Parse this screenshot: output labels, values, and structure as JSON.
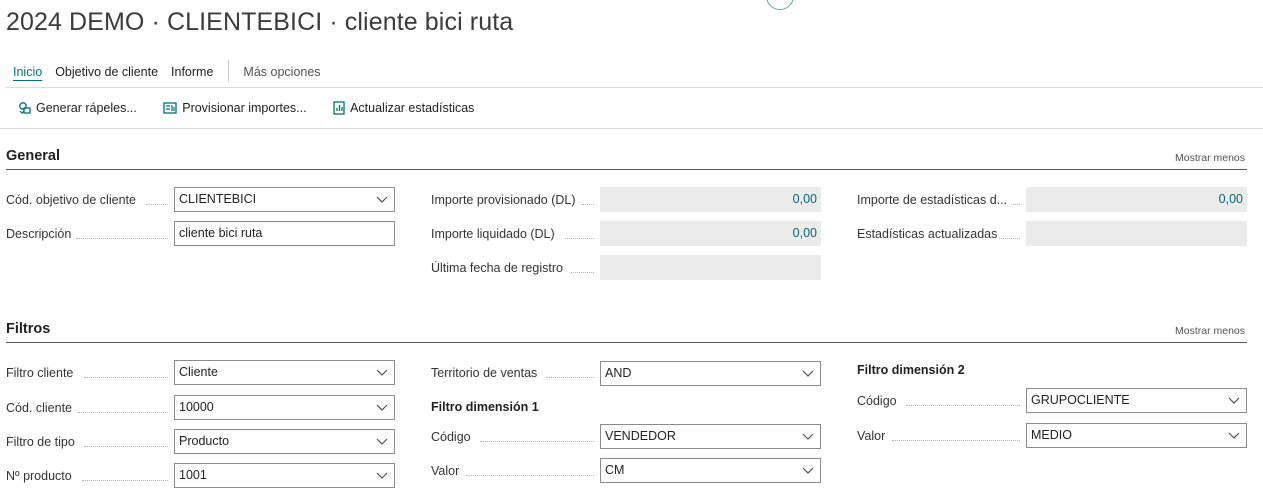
{
  "page_title": "2024 DEMO · CLIENTEBICI · cliente bici ruta",
  "nav": {
    "tabs": [
      "Inicio",
      "Objetivo de cliente",
      "Informe"
    ],
    "more": "Más opciones"
  },
  "actions": [
    {
      "label": "Generar rápeles...",
      "icon": "generate-icon"
    },
    {
      "label": "Provisionar importes...",
      "icon": "provision-icon"
    },
    {
      "label": "Actualizar estadísticas",
      "icon": "statistics-icon"
    }
  ],
  "general": {
    "title": "General",
    "more": "Mostrar menos",
    "cod_objetivo": {
      "label": "Cód. objetivo de cliente",
      "value": "CLIENTEBICI"
    },
    "descripcion": {
      "label": "Descripción",
      "value": "cliente bici ruta"
    },
    "importe_provisionado": {
      "label": "Importe provisionado (DL)",
      "value": "0,00"
    },
    "importe_liquidado": {
      "label": "Importe liquidado (DL)",
      "value": "0,00"
    },
    "ultima_fecha": {
      "label": "Última fecha de registro",
      "value": ""
    },
    "importe_estadisticas": {
      "label": "Importe de estadísticas d...",
      "value": "0,00"
    },
    "estadisticas_actualizadas": {
      "label": "Estadísticas actualizadas",
      "value": ""
    }
  },
  "filtros": {
    "title": "Filtros",
    "more": "Mostrar menos",
    "filtro_cliente": {
      "label": "Filtro cliente",
      "value": "Cliente"
    },
    "cod_cliente": {
      "label": "Cód. cliente",
      "value": "10000"
    },
    "filtro_tipo": {
      "label": "Filtro de tipo",
      "value": "Producto"
    },
    "n_producto": {
      "label": "Nº producto",
      "value": "1001"
    },
    "territorio": {
      "label": "Territorio de ventas",
      "value": "AND"
    },
    "dim1": {
      "title": "Filtro dimensión 1",
      "codigo": {
        "label": "Código",
        "value": "VENDEDOR"
      },
      "valor": {
        "label": "Valor",
        "value": "CM"
      }
    },
    "dim2": {
      "title": "Filtro dimensión 2",
      "codigo": {
        "label": "Código",
        "value": "GRUPOCLIENTE"
      },
      "valor": {
        "label": "Valor",
        "value": "MEDIO"
      }
    }
  },
  "colors": {
    "accent": "#00707a",
    "readonly_bg": "#ebebeb",
    "value_text": "#00697a"
  }
}
